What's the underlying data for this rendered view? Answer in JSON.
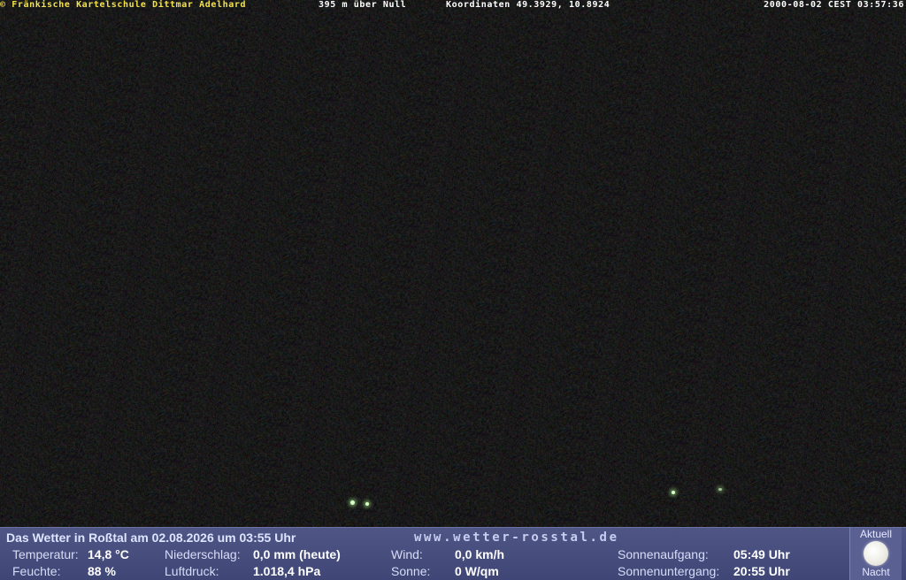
{
  "overlay": {
    "owner": "© Fränkische Kartelschule Dittmar Adelhard",
    "altitude": "395 m über Null",
    "coordinates": "Koordinaten 49.3929, 10.8924",
    "timestamp": "2000-08-02 CEST 03:57:36"
  },
  "weather": {
    "title": "Das Wetter in Roßtal am 02.08.2026 um 03:55 Uhr",
    "website": "www.wetter-rosstal.de",
    "temperature": {
      "label": "Temperatur:",
      "value": "14,8 °C"
    },
    "humidity": {
      "label": "Feuchte:",
      "value": "88 %"
    },
    "precipitation": {
      "label": "Niederschlag:",
      "value": "0,0 mm (heute)"
    },
    "pressure": {
      "label": "Luftdruck:",
      "value": "1.018,4 hPa"
    },
    "wind": {
      "label": "Wind:",
      "value": "0,0 km/h"
    },
    "sun": {
      "label": "Sonne:",
      "value": "0 W/qm"
    },
    "sunrise": {
      "label": "Sonnenaufgang:",
      "value": "05:49 Uhr"
    },
    "sunset": {
      "label": "Sonnenuntergang:",
      "value": "20:55 Uhr"
    }
  },
  "moon": {
    "current_label": "Aktuell",
    "phase_label": "Nacht",
    "icon": "full-moon-icon"
  },
  "colors": {
    "owner_text": "#f3e24a",
    "weather_bar": "#4f5686"
  }
}
